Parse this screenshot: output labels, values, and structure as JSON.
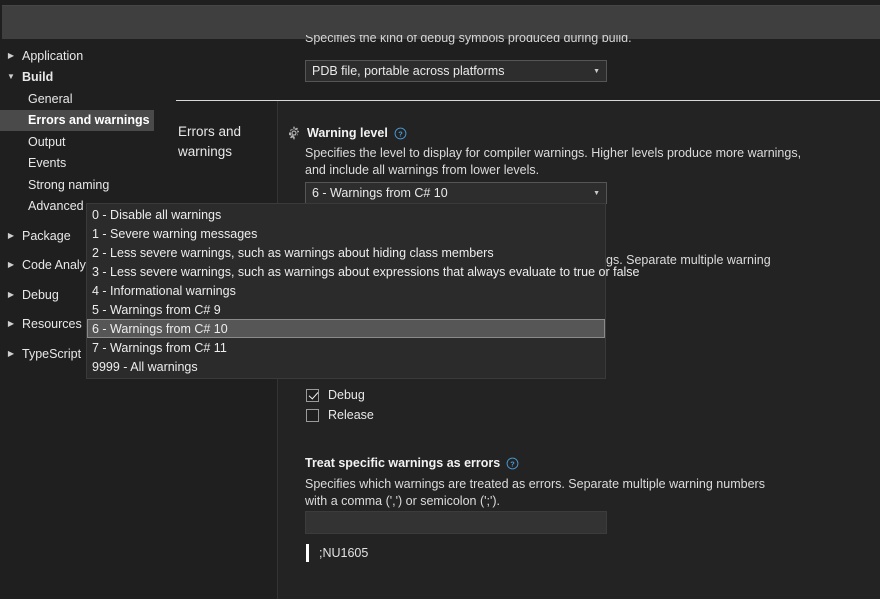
{
  "window": {
    "background_color": "#1f1f1f",
    "panel_color": "#232323",
    "accent_color": "#4a4a4a",
    "help_icon_color": "#4a9edb"
  },
  "sidebar": {
    "items": [
      {
        "label": "Application",
        "twisty": "collapsed",
        "level": "top",
        "selected": false
      },
      {
        "label": "Build",
        "twisty": "expanded",
        "level": "top",
        "selected": false
      },
      {
        "label": "General",
        "twisty": "none",
        "level": "child",
        "selected": false
      },
      {
        "label": "Errors and warnings",
        "twisty": "none",
        "level": "child",
        "selected": true
      },
      {
        "label": "Output",
        "twisty": "none",
        "level": "child",
        "selected": false
      },
      {
        "label": "Events",
        "twisty": "none",
        "level": "child",
        "selected": false
      },
      {
        "label": "Strong naming",
        "twisty": "none",
        "level": "child",
        "selected": false
      },
      {
        "label": "Advanced",
        "twisty": "none",
        "level": "child",
        "selected": false
      },
      {
        "label": "Package",
        "twisty": "collapsed",
        "level": "top",
        "selected": false
      },
      {
        "label": "Code Analysis",
        "twisty": "collapsed",
        "level": "top",
        "selected": false
      },
      {
        "label": "Debug",
        "twisty": "collapsed",
        "level": "top",
        "selected": false
      },
      {
        "label": "Resources",
        "twisty": "collapsed",
        "level": "top",
        "selected": false
      },
      {
        "label": "TypeScript",
        "twisty": "collapsed",
        "level": "top",
        "selected": false
      }
    ]
  },
  "section": {
    "title": "Errors and warnings"
  },
  "debug_symbols": {
    "description": "Specifies the kind of debug symbols produced during build.",
    "combo_value": "PDB file, portable across platforms"
  },
  "warning_level": {
    "heading": "Warning level",
    "description": "Specifies the level to display for compiler warnings. Higher levels produce more warnings, and include all warnings from lower levels.",
    "combo_value": "6 - Warnings from C# 10",
    "options": [
      "0 - Disable all warnings",
      "1 - Severe warning messages",
      "2 - Less severe warnings, such as warnings about hiding class members",
      "3 - Less severe warnings, such as warnings about expressions that always evaluate to true or false",
      "4 - Informational warnings",
      "5 - Warnings from C# 9",
      "6 - Warnings from C# 10",
      "7 - Warnings from C# 11",
      "9999 - All warnings"
    ],
    "selected_option": "6 - Warnings from C# 10"
  },
  "suppress_warnings": {
    "description_fragment": "gs. Separate multiple warning"
  },
  "configurations": {
    "items": [
      {
        "label": "Debug",
        "checked": true
      },
      {
        "label": "Release",
        "checked": false
      }
    ]
  },
  "treat_as_errors": {
    "heading": "Treat specific warnings as errors",
    "description": "Specifies which warnings are treated as errors. Separate multiple warning numbers with a comma (',') or semicolon (';').",
    "input_value": "",
    "input_placeholder": "",
    "message": ";NU1605"
  },
  "icons": {
    "gear": "gear-icon",
    "help": "help-circle-icon",
    "caret": "▾",
    "twisty_collapsed": "▷",
    "twisty_expanded": "◢"
  }
}
